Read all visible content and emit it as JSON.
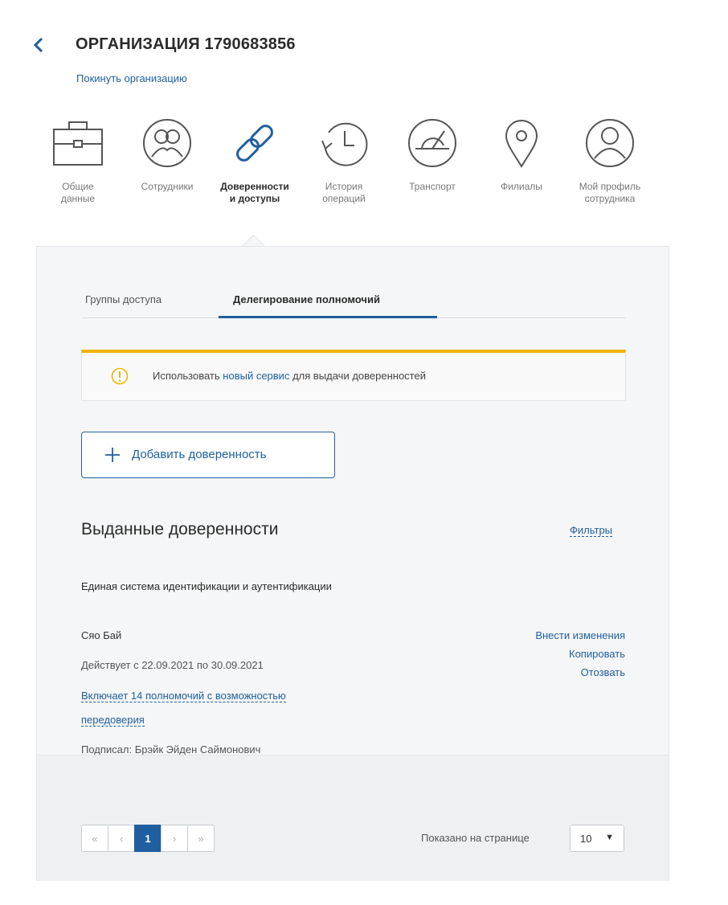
{
  "header": {
    "title": "ОРГАНИЗАЦИЯ 1790683856",
    "leave_link": "Покинуть организацию"
  },
  "nav": {
    "items": [
      {
        "label": "Общие\nданные",
        "icon": "briefcase-icon"
      },
      {
        "label": "Сотрудники",
        "icon": "people-icon"
      },
      {
        "label": "Доверенности\nи доступы",
        "icon": "link-icon",
        "active": true
      },
      {
        "label": "История\nопераций",
        "icon": "history-icon"
      },
      {
        "label": "Транспорт",
        "icon": "speedometer-icon"
      },
      {
        "label": "Филиалы",
        "icon": "location-pin-icon"
      },
      {
        "label": "Мой профиль\nсотрудника",
        "icon": "user-profile-icon"
      }
    ]
  },
  "tabs": [
    {
      "label": "Группы доступа"
    },
    {
      "label": "Делегирование полномочий",
      "active": true
    }
  ],
  "notice": {
    "text_before": "Использовать ",
    "link": "новый сервис",
    "text_after": " для выдачи доверенностей"
  },
  "add_button": {
    "label": "Добавить доверенность"
  },
  "issued": {
    "title": "Выданные доверенности",
    "filters": "Фильтры",
    "system": "Единая система идентификации и аутентификации",
    "record": {
      "person": "Сяо Бай",
      "validity": "Действует с 22.09.2021 по 30.09.2021",
      "powers_line1": "Включает 14 полномочий с возможностью",
      "powers_line2": "передоверия",
      "signed": "Подписал: Брэйк Эйден Саймонович"
    },
    "actions": {
      "edit": "Внести изменения",
      "copy": "Копировать",
      "revoke": "Отозвать"
    }
  },
  "pagination": {
    "first": "«",
    "prev": "‹",
    "current": "1",
    "next": "›",
    "last": "»",
    "per_page_label": "Показано на странице",
    "per_page_value": "10"
  },
  "colors": {
    "accent": "#1f5f9f",
    "warning": "#f0b400"
  }
}
